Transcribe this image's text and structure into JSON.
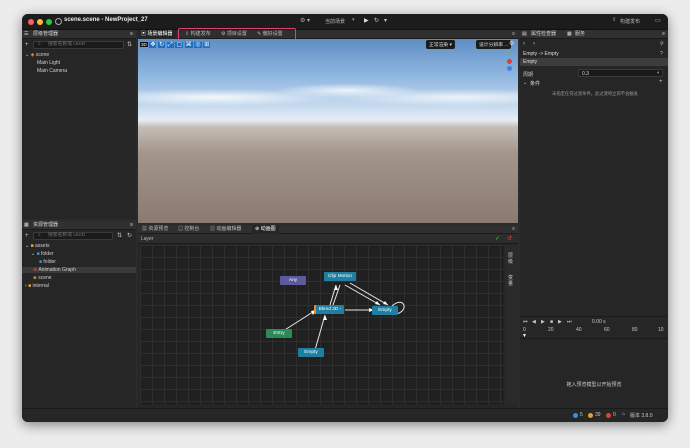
{
  "window": {
    "title": "scene.scene - NewProject_27"
  },
  "toolbar": {
    "scene_select": "当前场景",
    "publish_label": "构建发布"
  },
  "menu_highlight": {
    "items": [
      "构建发布",
      "项目设置",
      "偏好设置"
    ],
    "color": "#e0407a"
  },
  "hierarchy": {
    "title": "层级管理器",
    "search_placeholder": "搜索名称或 UUID",
    "items": [
      "scene",
      "Main Light",
      "Main Camera"
    ]
  },
  "assets": {
    "title": "资源管理器",
    "search_placeholder": "搜索名称或 UUID",
    "items": [
      "assets",
      "folder",
      "folder",
      "Animation Graph",
      "scene",
      "internal"
    ]
  },
  "scene_editor": {
    "title": "场景编辑器",
    "render_mode": "正常渲染",
    "resolution": "设计分辨率 ..."
  },
  "bottom_tabs": [
    "资源预览",
    "控制台",
    "动画编辑器",
    "动画图"
  ],
  "graph": {
    "layer_label": "Layer",
    "side_labels": [
      "层级",
      "变量"
    ],
    "nodes": {
      "any": "Any",
      "clip": "Clip Motion",
      "blend": "Blend 2D",
      "empty_right": "Empty",
      "entry": "Entry",
      "empty_bottom": "Empty"
    },
    "colors": {
      "any": "#5b5b9e",
      "state": "#1e7fa3",
      "entry": "#2a8a5a"
    }
  },
  "inspector": {
    "title": "属性检查器",
    "tab2": "服务",
    "breadcrumb": "Empty -> Empty",
    "header": "Empty",
    "duration_label": "周期",
    "duration_value": "0.3",
    "conditions_label": "条件",
    "conditions_empty": "未指定任何过渡条件。此过渡将立即不会触发",
    "time_label": "0.00 s",
    "ruler": [
      "0",
      "20",
      "40",
      "60",
      "80",
      "10"
    ],
    "preview_hint": "拖入预览模型以开始预览"
  },
  "statusbar": {
    "info": "5",
    "warn": "39",
    "err": "0",
    "version": "版本 3.8.0"
  }
}
